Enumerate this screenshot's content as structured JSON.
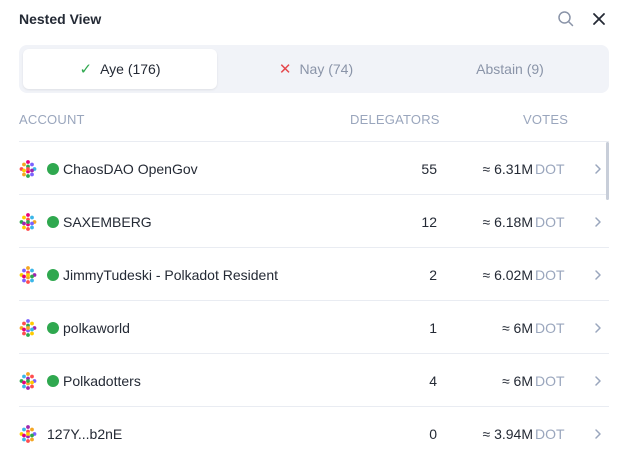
{
  "header": {
    "title": "Nested View"
  },
  "tabs": [
    {
      "label": "Aye (176)",
      "icon": "check-icon",
      "selected": true
    },
    {
      "label": "Nay (74)",
      "icon": "cross-icon",
      "selected": false
    },
    {
      "label": "Abstain (9)",
      "icon": "",
      "selected": false
    }
  ],
  "columns": {
    "account": "ACCOUNT",
    "delegators": "DELEGATORS",
    "votes": "VOTES"
  },
  "rows": [
    {
      "name": "ChaosDAO OpenGov",
      "verified": true,
      "delegators": "55",
      "votes": "≈ 6.31M",
      "unit": "DOT"
    },
    {
      "name": "SAXEMBERG",
      "verified": true,
      "delegators": "12",
      "votes": "≈ 6.18M",
      "unit": "DOT"
    },
    {
      "name": "JimmyTudeski - Polkadot Resident",
      "verified": true,
      "delegators": "2",
      "votes": "≈ 6.02M",
      "unit": "DOT"
    },
    {
      "name": "polkaworld",
      "verified": true,
      "delegators": "1",
      "votes": "≈ 6M",
      "unit": "DOT"
    },
    {
      "name": "Polkadotters",
      "verified": true,
      "delegators": "4",
      "votes": "≈ 6M",
      "unit": "DOT"
    },
    {
      "name": "127Y...b2nE",
      "verified": false,
      "delegators": "0",
      "votes": "≈ 3.94M",
      "unit": "DOT"
    }
  ],
  "colors": {
    "accent_green": "#2fa84f",
    "nay_red": "#e5484d",
    "muted": "#9aa6bd"
  }
}
